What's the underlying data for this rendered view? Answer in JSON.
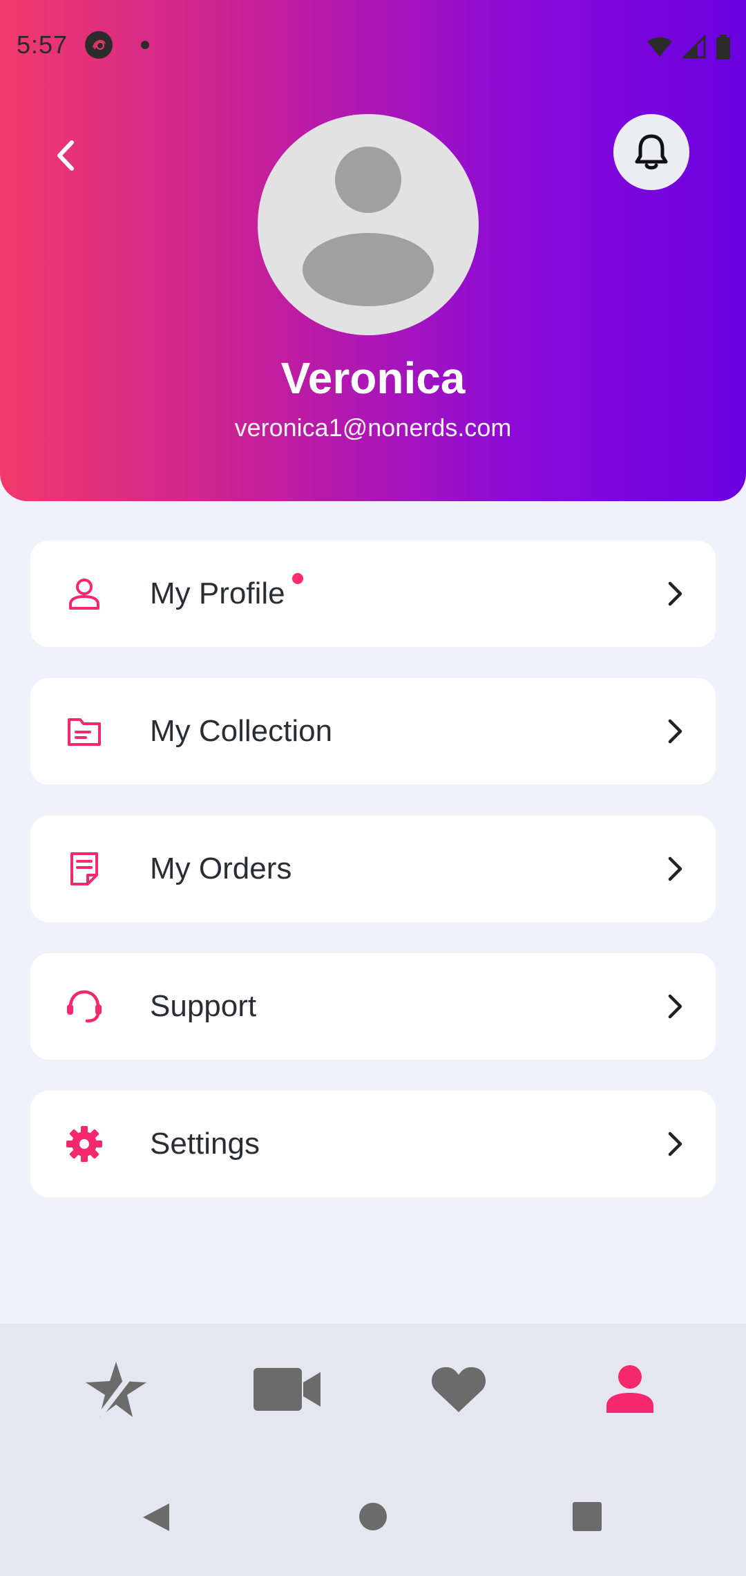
{
  "status_bar": {
    "time": "5:57"
  },
  "profile": {
    "name": "Veronica",
    "email": "veronica1@nonerds.com"
  },
  "menu": {
    "items": [
      {
        "label": "My Profile",
        "icon": "person-outline-icon",
        "has_dot": true
      },
      {
        "label": "My Collection",
        "icon": "folder-icon",
        "has_dot": false
      },
      {
        "label": "My Orders",
        "icon": "document-icon",
        "has_dot": false
      },
      {
        "label": "Support",
        "icon": "headset-icon",
        "has_dot": false
      },
      {
        "label": "Settings",
        "icon": "gear-icon",
        "has_dot": false
      }
    ]
  },
  "bottom_nav": {
    "items": [
      {
        "icon": "star-icon",
        "active": false
      },
      {
        "icon": "video-camera-icon",
        "active": false
      },
      {
        "icon": "heart-icon",
        "active": false
      },
      {
        "icon": "person-icon",
        "active": true
      }
    ]
  },
  "colors": {
    "accent": "#f5286e",
    "gradient_start": "#f2396a",
    "gradient_end": "#6a00e0",
    "inactive_icon": "#6b6b6b"
  }
}
